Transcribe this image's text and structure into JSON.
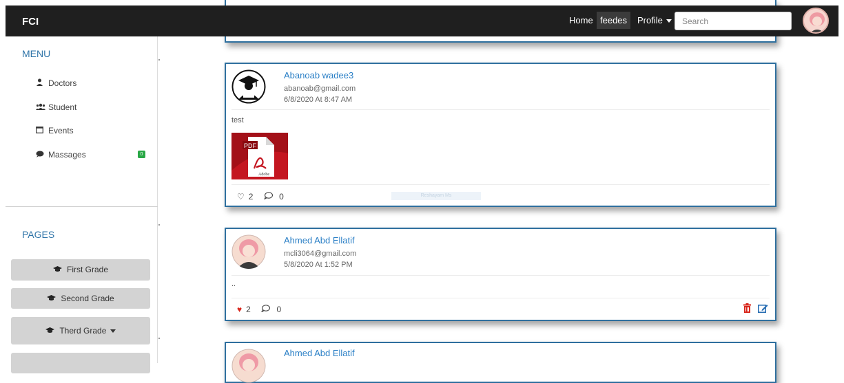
{
  "navbar": {
    "brand": "FCI",
    "links": {
      "home": "Home",
      "feedes": "feedes",
      "profile": "Profile"
    },
    "search_placeholder": "Search",
    "dark_color": "#1f1f1f"
  },
  "sidebar": {
    "menu_title": "MENU",
    "menu_items": [
      {
        "label": "Doctors",
        "icon": "user-tie-icon"
      },
      {
        "label": "Student",
        "icon": "users-icon"
      },
      {
        "label": "Events",
        "icon": "calendar-icon"
      },
      {
        "label": "Massages",
        "icon": "comment-icon",
        "badge": "0"
      }
    ],
    "pages_title": "PAGES",
    "pages": [
      {
        "label": "First Grade",
        "icon": "graduation-cap-icon"
      },
      {
        "label": "Second Grade",
        "icon": "graduation-cap-icon"
      },
      {
        "label": "Therd Grade",
        "icon": "graduation-cap-icon",
        "dropdown": true
      }
    ]
  },
  "posts": [
    {
      "author": "Abanoab wadee3",
      "email": "abanoab@gmail.com",
      "date": "6/8/2020 At 8:47 AM",
      "text": "test",
      "attachment": {
        "type": "pdf",
        "label_top": "PDF",
        "label_bottom": "Adobe"
      },
      "likes": "2",
      "comments": "0",
      "liked": false,
      "faded_text": "Reshayam Ms"
    },
    {
      "author": "Ahmed Abd Ellatif",
      "email": "mcli3064@gmail.com",
      "date": "5/8/2020 At 1:52 PM",
      "text": "..",
      "likes": "2",
      "comments": "0",
      "liked": true,
      "owner_actions": true
    },
    {
      "author": "Ahmed Abd Ellatif"
    }
  ],
  "colors": {
    "accent": "#2e6f9e",
    "link": "#2a7fc6",
    "like_red": "#d9281e",
    "badge_green": "#28a745"
  }
}
